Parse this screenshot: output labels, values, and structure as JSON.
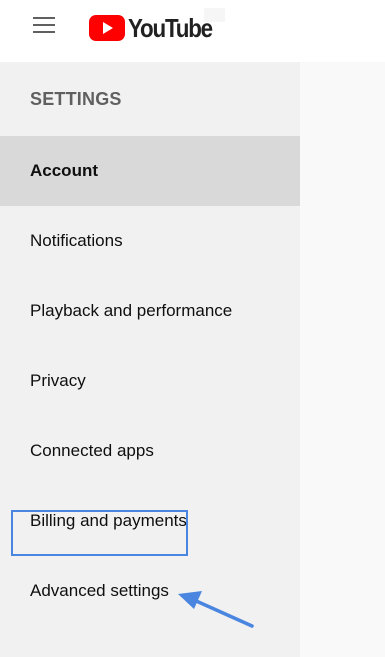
{
  "header": {
    "logo_text": "YouTube",
    "menu_icon": "hamburger-menu-icon",
    "logo_icon": "youtube-play-icon"
  },
  "sidebar": {
    "heading": "SETTINGS",
    "items": [
      {
        "label": "Account",
        "selected": true
      },
      {
        "label": "Notifications",
        "selected": false
      },
      {
        "label": "Playback and performance",
        "selected": false
      },
      {
        "label": "Privacy",
        "selected": false
      },
      {
        "label": "Connected apps",
        "selected": false
      },
      {
        "label": "Billing and payments",
        "selected": false
      },
      {
        "label": "Advanced settings",
        "selected": false
      }
    ]
  },
  "annotation": {
    "highlight_color": "#4a86e0",
    "arrow_icon": "pointer-arrow-icon"
  },
  "colors": {
    "brand_red": "#ff0000",
    "sidebar_bg": "#f1f1f1",
    "selected_bg": "#d9d9d9"
  }
}
